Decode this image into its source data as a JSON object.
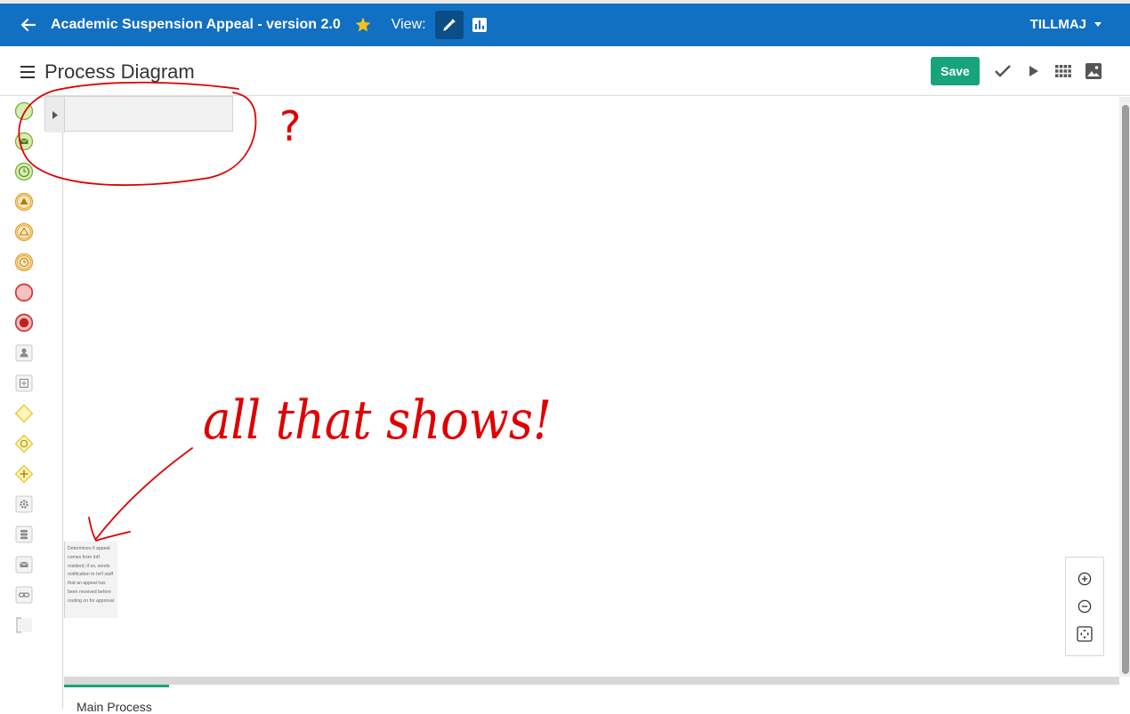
{
  "topbar": {
    "title": "Academic Suspension Appeal - version 2.0",
    "view_label": "View:",
    "user": "TILLMAJ",
    "bg_color": "#1170c1",
    "star_color": "#f6c21a"
  },
  "header": {
    "page_title": "Process Diagram",
    "save_label": "Save",
    "save_color": "#17a47a"
  },
  "icons": {
    "topbar": [
      "arrow-left-icon",
      "star-icon",
      "pencil-icon",
      "bar-chart-icon",
      "caret-down-icon"
    ],
    "toolbar": [
      "checkmark-icon",
      "play-icon",
      "grid-icon",
      "image-icon"
    ],
    "palette": [
      "start-event-icon",
      "message-start-event-icon",
      "timer-start-event-icon",
      "signal-intermediate-event-icon",
      "signal-catch-event-icon",
      "timer-intermediate-event-icon",
      "end-event-icon",
      "terminate-end-event-icon",
      "user-task-icon",
      "subprocess-icon",
      "exclusive-gateway-icon",
      "inclusive-gateway-icon",
      "parallel-gateway-icon",
      "service-task-icon",
      "data-store-icon",
      "message-task-icon",
      "link-icon",
      "annotation-icon"
    ],
    "zoom": [
      "zoom-in-icon",
      "zoom-out-icon",
      "fit-screen-icon"
    ]
  },
  "canvas": {
    "annotation_text": "Determines if appeal comes from Int'l resident; if so, sends notification to Int'l staff that an appeal has been received before routing on for approval",
    "handwritten_notes": [
      "?",
      "all that shows!"
    ]
  },
  "tabs": [
    {
      "label": "Main Process",
      "active": true
    }
  ]
}
